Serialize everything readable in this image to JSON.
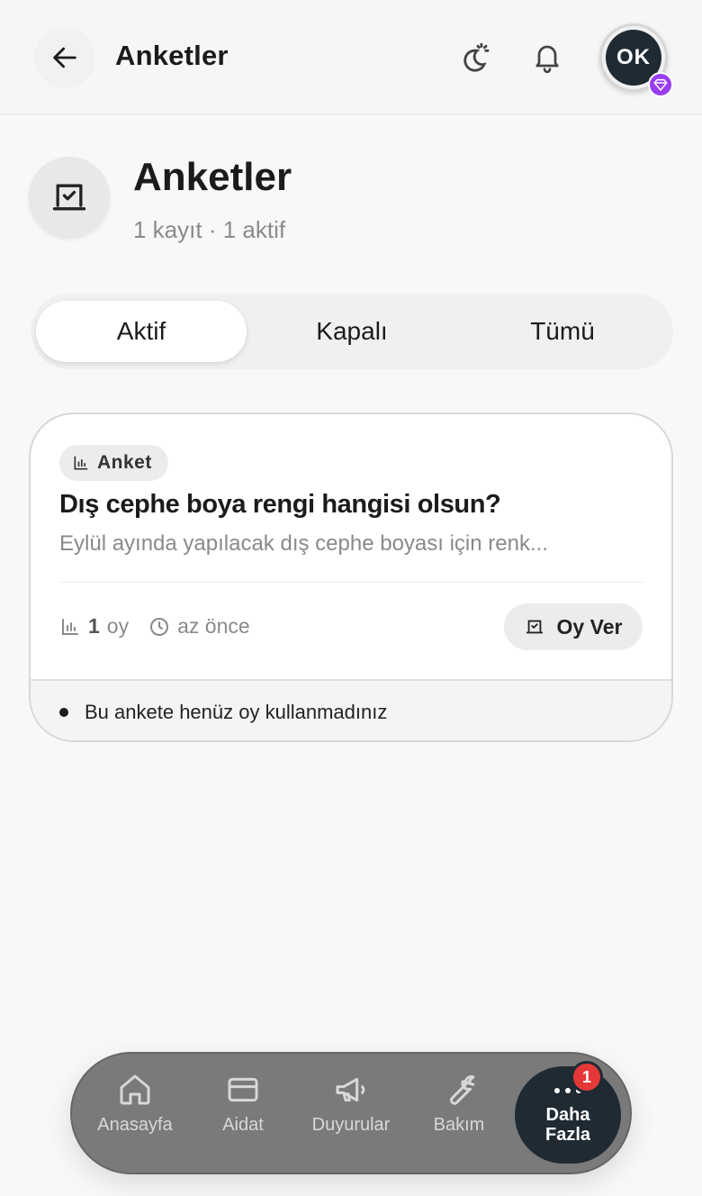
{
  "header": {
    "title": "Anketler",
    "avatar_initials": "OK"
  },
  "page": {
    "title": "Anketler",
    "subtitle": "1 kayıt · 1 aktif"
  },
  "tabs": [
    {
      "label": "Aktif",
      "active": true
    },
    {
      "label": "Kapalı",
      "active": false
    },
    {
      "label": "Tümü",
      "active": false
    }
  ],
  "poll_card": {
    "badge": "Anket",
    "title": "Dış cephe boya rengi hangisi olsun?",
    "description": "Eylül ayında yapılacak dış cephe boyası için renk...",
    "votes_count": "1",
    "votes_unit": "oy",
    "time": "az önce",
    "vote_button": "Oy Ver",
    "footer": "Bu ankete henüz oy kullanmadınız"
  },
  "bottom_nav": {
    "items": [
      {
        "label": "Anasayfa",
        "icon": "home-icon"
      },
      {
        "label": "Aidat",
        "icon": "card-icon"
      },
      {
        "label": "Duyurular",
        "icon": "megaphone-icon"
      },
      {
        "label": "Bakım",
        "icon": "wrench-icon"
      }
    ],
    "more": {
      "label_line1": "Daha",
      "label_line2": "Fazla",
      "badge": "1"
    }
  },
  "colors": {
    "accent_dark": "#1f2a33",
    "premium": "#9a3df0",
    "notification": "#e53838"
  }
}
